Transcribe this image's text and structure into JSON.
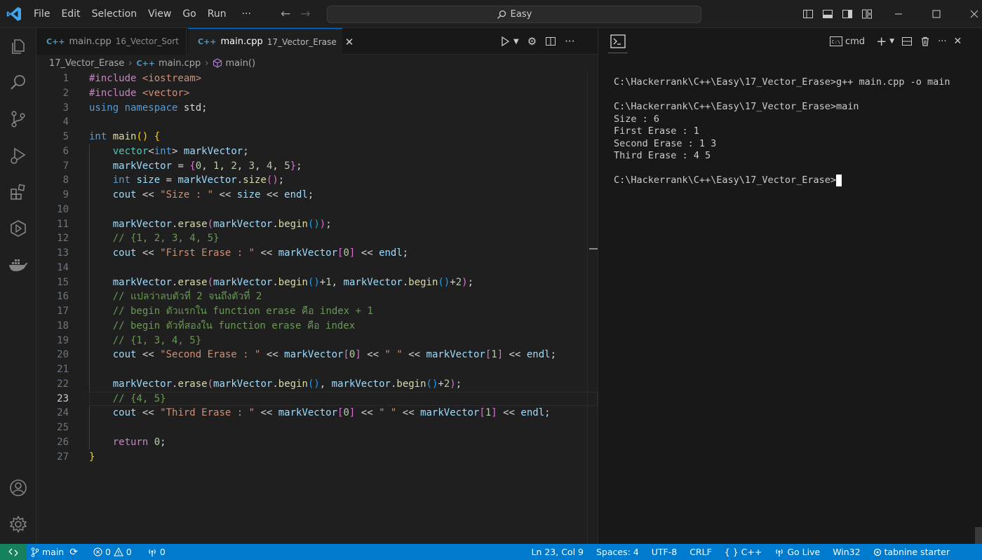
{
  "menu": [
    "File",
    "Edit",
    "Selection",
    "View",
    "Go",
    "Run",
    "···"
  ],
  "search": {
    "label": "Easy"
  },
  "tabs": [
    {
      "icon": "C++",
      "name": "main.cpp",
      "desc": "16_Vector_Sort",
      "active": false
    },
    {
      "icon": "C++",
      "name": "main.cpp",
      "desc": "17_Vector_Erase",
      "active": true
    }
  ],
  "breadcrumb": {
    "folder": "17_Vector_Erase",
    "file": "main.cpp",
    "symbol": "main()"
  },
  "editor": {
    "current_line": 23,
    "lines": [
      [
        [
          "pp",
          "#include "
        ],
        [
          "s",
          "<iostream>"
        ]
      ],
      [
        [
          "pp",
          "#include "
        ],
        [
          "s",
          "<vector>"
        ]
      ],
      [
        [
          "k",
          "using "
        ],
        [
          "k",
          "namespace "
        ],
        [
          "p",
          "std;"
        ]
      ],
      [],
      [
        [
          "k",
          "int "
        ],
        [
          "f",
          "main"
        ],
        [
          "b1",
          "() {"
        ]
      ],
      [
        [
          "p",
          "    "
        ],
        [
          "t",
          "vector"
        ],
        [
          "p",
          "<"
        ],
        [
          "k",
          "int"
        ],
        [
          "p",
          "> "
        ],
        [
          "v",
          "markVector"
        ],
        [
          "p",
          ";"
        ]
      ],
      [
        [
          "p",
          "    "
        ],
        [
          "v",
          "markVector"
        ],
        [
          "p",
          " = "
        ],
        [
          "b2",
          "{"
        ],
        [
          "n",
          "0"
        ],
        [
          "p",
          ", "
        ],
        [
          "n",
          "1"
        ],
        [
          "p",
          ", "
        ],
        [
          "n",
          "2"
        ],
        [
          "p",
          ", "
        ],
        [
          "n",
          "3"
        ],
        [
          "p",
          ", "
        ],
        [
          "n",
          "4"
        ],
        [
          "p",
          ", "
        ],
        [
          "n",
          "5"
        ],
        [
          "b2",
          "}"
        ],
        [
          "p",
          ";"
        ]
      ],
      [
        [
          "p",
          "    "
        ],
        [
          "k",
          "int "
        ],
        [
          "v",
          "size"
        ],
        [
          "p",
          " = "
        ],
        [
          "v",
          "markVector"
        ],
        [
          "p",
          "."
        ],
        [
          "f",
          "size"
        ],
        [
          "b2",
          "()"
        ],
        [
          "p",
          ";"
        ]
      ],
      [
        [
          "p",
          "    "
        ],
        [
          "v",
          "cout"
        ],
        [
          "p",
          " << "
        ],
        [
          "s",
          "\"Size : \""
        ],
        [
          "p",
          " << "
        ],
        [
          "v",
          "size"
        ],
        [
          "p",
          " << "
        ],
        [
          "v",
          "endl"
        ],
        [
          "p",
          ";"
        ]
      ],
      [],
      [
        [
          "p",
          "    "
        ],
        [
          "v",
          "markVector"
        ],
        [
          "p",
          "."
        ],
        [
          "f",
          "erase"
        ],
        [
          "b2",
          "("
        ],
        [
          "v",
          "markVector"
        ],
        [
          "p",
          "."
        ],
        [
          "f",
          "begin"
        ],
        [
          "b3",
          "()"
        ],
        [
          "b2",
          ")"
        ],
        [
          "p",
          ";"
        ]
      ],
      [
        [
          "p",
          "    "
        ],
        [
          "c",
          "// {1, 2, 3, 4, 5}"
        ]
      ],
      [
        [
          "p",
          "    "
        ],
        [
          "v",
          "cout"
        ],
        [
          "p",
          " << "
        ],
        [
          "s",
          "\"First Erase : \""
        ],
        [
          "p",
          " << "
        ],
        [
          "v",
          "markVector"
        ],
        [
          "b2",
          "["
        ],
        [
          "n",
          "0"
        ],
        [
          "b2",
          "]"
        ],
        [
          "p",
          " << "
        ],
        [
          "v",
          "endl"
        ],
        [
          "p",
          ";"
        ]
      ],
      [],
      [
        [
          "p",
          "    "
        ],
        [
          "v",
          "markVector"
        ],
        [
          "p",
          "."
        ],
        [
          "f",
          "erase"
        ],
        [
          "b2",
          "("
        ],
        [
          "v",
          "markVector"
        ],
        [
          "p",
          "."
        ],
        [
          "f",
          "begin"
        ],
        [
          "b3",
          "()"
        ],
        [
          "p",
          "+"
        ],
        [
          "n",
          "1"
        ],
        [
          "p",
          ", "
        ],
        [
          "v",
          "markVector"
        ],
        [
          "p",
          "."
        ],
        [
          "f",
          "begin"
        ],
        [
          "b3",
          "()"
        ],
        [
          "p",
          "+"
        ],
        [
          "n",
          "2"
        ],
        [
          "b2",
          ")"
        ],
        [
          "p",
          ";"
        ]
      ],
      [
        [
          "p",
          "    "
        ],
        [
          "c",
          "// แปลว่าลบตัวที่ 2 จนถึงตัวที่ 2"
        ]
      ],
      [
        [
          "p",
          "    "
        ],
        [
          "c",
          "// begin ตัวแรกใน function erase คือ index + 1"
        ]
      ],
      [
        [
          "p",
          "    "
        ],
        [
          "c",
          "// begin ตัวที่สองใน function erase คือ index"
        ]
      ],
      [
        [
          "p",
          "    "
        ],
        [
          "c",
          "// {1, 3, 4, 5}"
        ]
      ],
      [
        [
          "p",
          "    "
        ],
        [
          "v",
          "cout"
        ],
        [
          "p",
          " << "
        ],
        [
          "s",
          "\"Second Erase : \""
        ],
        [
          "p",
          " << "
        ],
        [
          "v",
          "markVector"
        ],
        [
          "b2",
          "["
        ],
        [
          "n",
          "0"
        ],
        [
          "b2",
          "]"
        ],
        [
          "p",
          " << "
        ],
        [
          "s",
          "\" \""
        ],
        [
          "p",
          " << "
        ],
        [
          "v",
          "markVector"
        ],
        [
          "b2",
          "["
        ],
        [
          "n",
          "1"
        ],
        [
          "b2",
          "]"
        ],
        [
          "p",
          " << "
        ],
        [
          "v",
          "endl"
        ],
        [
          "p",
          ";"
        ]
      ],
      [],
      [
        [
          "p",
          "    "
        ],
        [
          "v",
          "markVector"
        ],
        [
          "p",
          "."
        ],
        [
          "f",
          "erase"
        ],
        [
          "b2",
          "("
        ],
        [
          "v",
          "markVector"
        ],
        [
          "p",
          "."
        ],
        [
          "f",
          "begin"
        ],
        [
          "b3",
          "()"
        ],
        [
          "p",
          ", "
        ],
        [
          "v",
          "markVector"
        ],
        [
          "p",
          "."
        ],
        [
          "f",
          "begin"
        ],
        [
          "b3",
          "()"
        ],
        [
          "p",
          "+"
        ],
        [
          "n",
          "2"
        ],
        [
          "b2",
          ")"
        ],
        [
          "p",
          ";"
        ]
      ],
      [
        [
          "p",
          "    "
        ],
        [
          "c",
          "// {4, 5}"
        ]
      ],
      [
        [
          "p",
          "    "
        ],
        [
          "v",
          "cout"
        ],
        [
          "p",
          " << "
        ],
        [
          "s",
          "\"Third Erase : \""
        ],
        [
          "p",
          " << "
        ],
        [
          "v",
          "markVector"
        ],
        [
          "b2",
          "["
        ],
        [
          "n",
          "0"
        ],
        [
          "b2",
          "]"
        ],
        [
          "p",
          " << "
        ],
        [
          "s",
          "\" \""
        ],
        [
          "p",
          " << "
        ],
        [
          "v",
          "markVector"
        ],
        [
          "b2",
          "["
        ],
        [
          "n",
          "1"
        ],
        [
          "b2",
          "]"
        ],
        [
          "p",
          " << "
        ],
        [
          "v",
          "endl"
        ],
        [
          "p",
          ";"
        ]
      ],
      [],
      [
        [
          "p",
          "    "
        ],
        [
          "pp",
          "return "
        ],
        [
          "n",
          "0"
        ],
        [
          "p",
          ";"
        ]
      ],
      [
        [
          "b1",
          "}"
        ]
      ]
    ]
  },
  "terminal": {
    "shell": "cmd",
    "lines": [
      "C:\\Hackerrank\\C++\\Easy\\17_Vector_Erase>g++ main.cpp -o main",
      "",
      "C:\\Hackerrank\\C++\\Easy\\17_Vector_Erase>main",
      "Size : 6",
      "First Erase : 1",
      "Second Erase : 1 3",
      "Third Erase : 4 5",
      "",
      "C:\\Hackerrank\\C++\\Easy\\17_Vector_Erase>"
    ]
  },
  "status": {
    "branch": "main",
    "errors": "0",
    "warnings": "0",
    "ports": "0",
    "position": "Ln 23, Col 9",
    "spaces": "Spaces: 4",
    "encoding": "UTF-8",
    "eol": "CRLF",
    "language": "C++",
    "golive": "Go Live",
    "platform": "Win32",
    "tabnine": "tabnine starter"
  },
  "colors": {
    "accent": "#0078d4",
    "statusbar": "#007acc",
    "remote": "#16825d"
  }
}
